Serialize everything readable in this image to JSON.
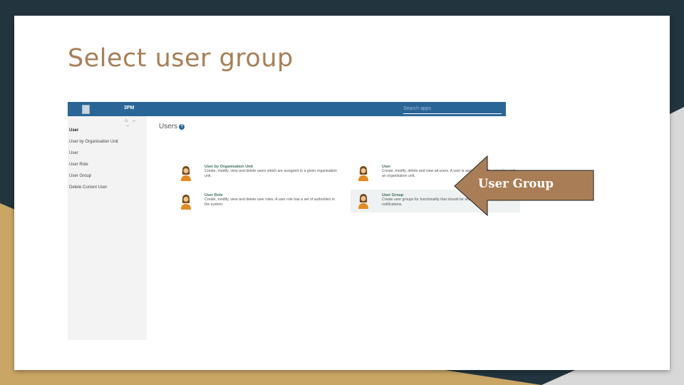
{
  "colors": {
    "slide_bg": "#ffffff",
    "title": "#a77f57",
    "topbar": "#2a6597",
    "arrow_fill": "#a97e56",
    "dark_bg": "#22343e",
    "tan_bg": "#c9a664"
  },
  "slide": {
    "title": "Select user group"
  },
  "app": {
    "name": "3PM",
    "search_placeholder": "Search apps",
    "nav_icons": "⌂ ← →",
    "sidebar": {
      "items": [
        {
          "label": "User",
          "active": true
        },
        {
          "label": "User by Organisation Unit"
        },
        {
          "label": "User"
        },
        {
          "label": "User Role"
        },
        {
          "label": "User Group"
        },
        {
          "label": "Delete Current User"
        }
      ]
    },
    "main": {
      "title": "Users",
      "help_icon": "?",
      "cards": [
        {
          "title": "User by Organisation Unit",
          "desc": "Create, modify, view and delete users which are assigned to a given organisation unit.",
          "icon": "user-icon"
        },
        {
          "title": "User",
          "desc": "Create, modify, delete and view all users. A user is associated with user roles and an organisation unit.",
          "icon": "user-icon"
        },
        {
          "title": "User Role",
          "desc": "Create, modify, view and delete user roles. A user role has a set of authorities in the system.",
          "icon": "user-icon"
        },
        {
          "title": "User Group",
          "desc": "Create user groups for functionality that should be shared among users, like notifications.",
          "icon": "user-icon",
          "highlighted": true
        }
      ]
    }
  },
  "callout": {
    "label": "User Group"
  }
}
